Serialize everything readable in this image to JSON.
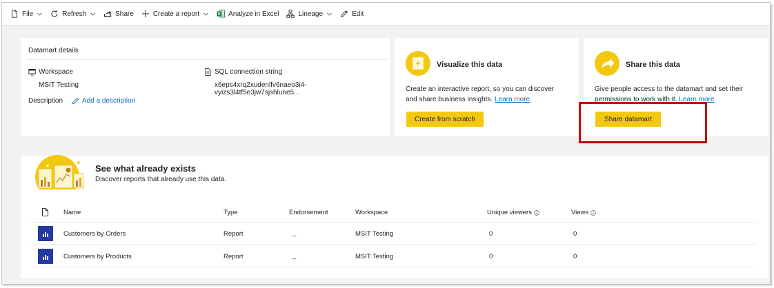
{
  "toolbar": {
    "file": "File",
    "refresh": "Refresh",
    "share": "Share",
    "create_report": "Create a report",
    "analyze": "Analyze in Excel",
    "lineage": "Lineage",
    "edit": "Edit"
  },
  "details": {
    "title": "Datamart details",
    "workspace_label": "Workspace",
    "workspace_value": "MSIT Testing",
    "sql_label": "SQL connection string",
    "sql_value": "x6eps4xrq2xudenlfv6naeo3i4-vyizs3l4tf5e3jw7sjshlune5...",
    "description_label": "Description",
    "add_description": "Add a description"
  },
  "visualize": {
    "title": "Visualize this data",
    "desc": "Create an interactive report, so you can discover and share business insights.",
    "learn_more": "Learn more",
    "button": "Create from scratch"
  },
  "share": {
    "title": "Share this data",
    "desc": "Give people access to the datamart and set their permissions to work with it.",
    "learn_more": "Learn more",
    "button": "Share datamart"
  },
  "exists": {
    "title": "See what already exists",
    "subtitle": "Discover reports that already use this data."
  },
  "table": {
    "headers": {
      "name": "Name",
      "type": "Type",
      "endorsement": "Endorsement",
      "workspace": "Workspace",
      "unique_viewers": "Unique viewers",
      "views": "Views"
    },
    "rows": [
      {
        "name": "Customers by Orders",
        "type": "Report",
        "endorsement": "_",
        "workspace": "MSIT Testing",
        "unique_viewers": "0",
        "views": "0"
      },
      {
        "name": "Customers by Products",
        "type": "Report",
        "endorsement": "_",
        "workspace": "MSIT Testing",
        "unique_viewers": "0",
        "views": "0"
      }
    ]
  },
  "colors": {
    "accent": "#f2c811",
    "link": "#106ebe",
    "highlight": "#c00000",
    "report_icon": "#243a9e"
  }
}
